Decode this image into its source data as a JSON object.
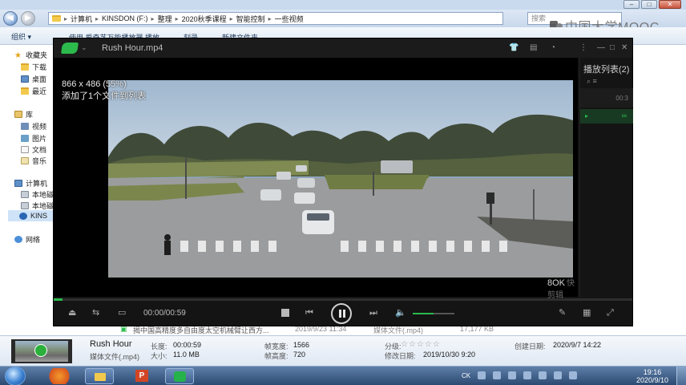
{
  "explorer": {
    "breadcrumb": [
      "计算机",
      "KINSDON (F:)",
      "整理",
      "2020秋季课程",
      "智能控制",
      "一些视频"
    ],
    "search_placeholder": "搜索",
    "watermark": "中国大学MOOC",
    "toolbar": {
      "organize": "组织",
      "items": [
        "使用 爱奇艺万能播放器 播放",
        "刻录",
        "新建文件夹"
      ]
    },
    "nav": {
      "favorites": "收藏夹",
      "downloads": "下载",
      "desktop": "桌面",
      "recent": "最近",
      "libraries": "库",
      "videos": "视频",
      "pictures": "图片",
      "documents": "文档",
      "music": "音乐",
      "computer": "计算机",
      "local_c": "本地磁",
      "local_d": "本地磁",
      "kinsdon": "KINS",
      "network": "网络"
    },
    "bg_file": {
      "name": "揭中国高精度多自由度太空机械臂让西方...",
      "date": "2019/9/23 11:34",
      "type": "媒体文件(.mp4)",
      "size": "17,177 KB"
    }
  },
  "details": {
    "name": "Rush Hour",
    "type": "媒体文件(.mp4)",
    "length_label": "长度:",
    "length": "00:00:59",
    "size_label": "大小:",
    "size": "11.0 MB",
    "width_label": "帧宽度:",
    "width": "1566",
    "height_label": "帧高度:",
    "height": "720",
    "rating_label": "分级:",
    "modified_label": "修改日期:",
    "modified": "2019/10/30 9:20",
    "created_label": "创建日期:",
    "created": "2020/9/7 14:22"
  },
  "player": {
    "title": "Rush Hour.mp4",
    "osd_line1": "866 x 486 (55%)",
    "osd_line2": "添加了1个文件到列表",
    "time": "00:00/00:59",
    "progress_fraction": 0.015,
    "volume_fraction": 0.5,
    "playlist_title": "播放列表(2)",
    "playlist_duration": "00:3",
    "watermark": "8OK",
    "watermark_sub": "快剪辑"
  },
  "taskbar": {
    "tray_text": "CK",
    "time": "19:16",
    "date": "2020/9/10"
  },
  "colors": {
    "accent_green": "#2cba4c",
    "taskbar": "#2c4a72"
  }
}
